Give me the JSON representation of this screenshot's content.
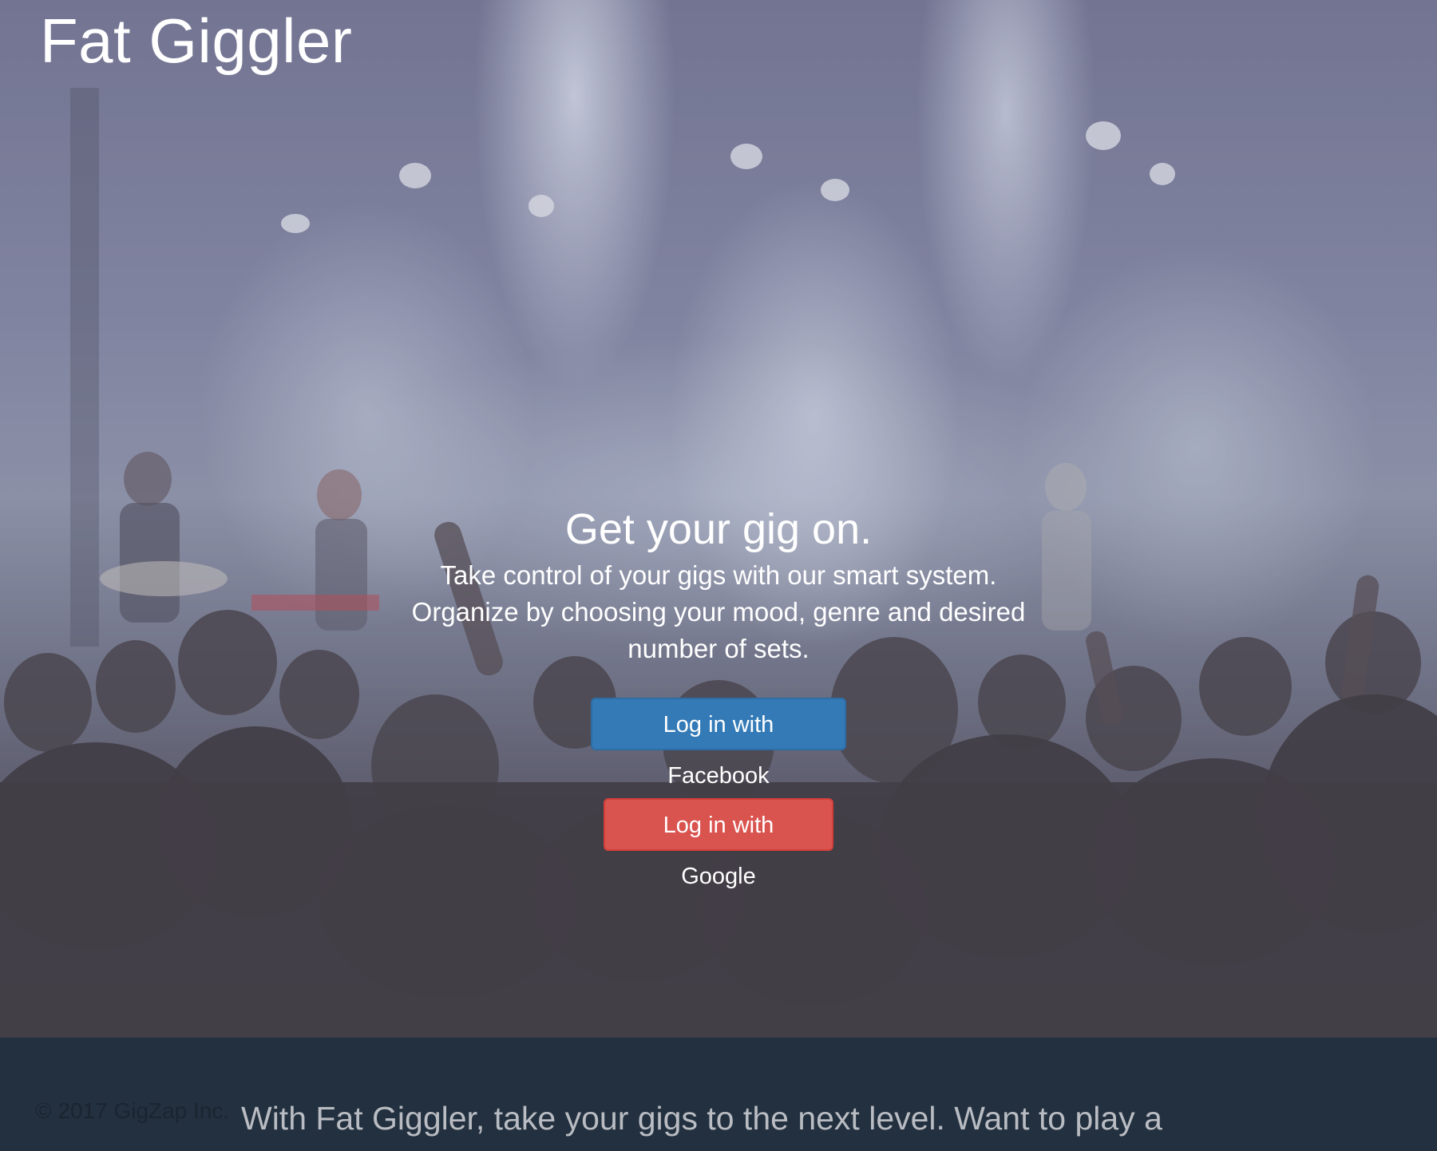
{
  "site": {
    "brand": "Fat Giggler"
  },
  "hero": {
    "headline": "Get your gig on.",
    "description": "Take control of your gigs with our smart system. Organize by choosing your mood, genre and desired number of sets.",
    "facebook_button": "Log in with Facebook",
    "google_button": "Log in with Google",
    "background_image": "concert-crowd-stage-lights"
  },
  "footer": {
    "copyright": "© 2017 GigZap Inc.",
    "text": "With Fat Giggler, take your gigs to the next level. Want to play a"
  },
  "colors": {
    "facebook": "#337ab7",
    "google": "#d9534f",
    "footer_bg": "#22303f"
  }
}
